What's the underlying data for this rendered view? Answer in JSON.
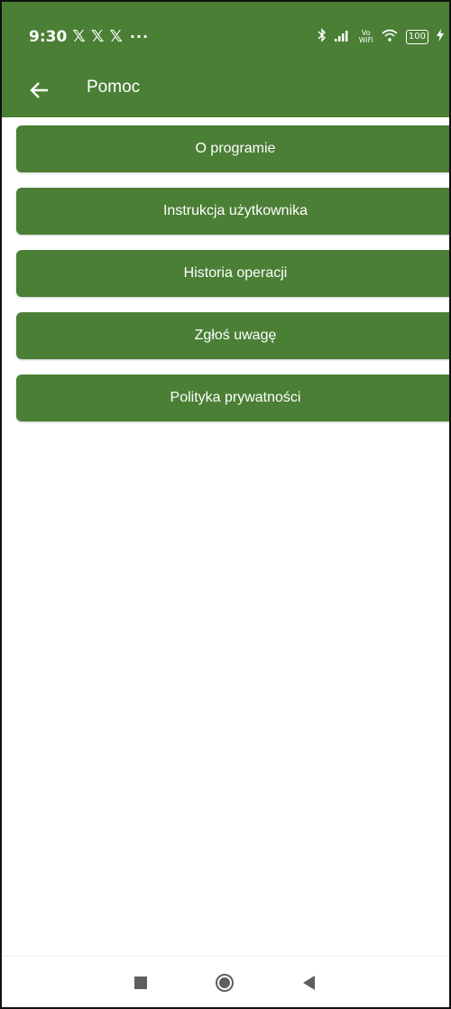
{
  "status_bar": {
    "time": "9:30",
    "notification_icons": [
      "𝕏",
      "𝕏",
      "𝕏"
    ],
    "more": "···",
    "icons": [
      "bluetooth-icon",
      "signal-icon",
      "vowifi-icon",
      "wifi-icon",
      "battery-icon",
      "charging-icon"
    ],
    "vowifi_top": "Vo",
    "vowifi_bottom": "WiFi",
    "battery": "100"
  },
  "toolbar": {
    "title": "Pomoc",
    "back_icon": "back-arrow-icon"
  },
  "menu": {
    "items": [
      {
        "label": "O programie"
      },
      {
        "label": "Instrukcja użytkownika"
      },
      {
        "label": "Historia operacji"
      },
      {
        "label": "Zgłoś uwagę"
      },
      {
        "label": "Polityka prywatności"
      }
    ]
  },
  "navigation_bar": {
    "buttons": [
      "recents-square-icon",
      "home-circle-icon",
      "back-triangle-icon"
    ]
  },
  "colors": {
    "primary": "#4a7f35",
    "on_primary": "#ffffff",
    "background": "#ffffff",
    "nav_icons": "#5f5f5f"
  }
}
